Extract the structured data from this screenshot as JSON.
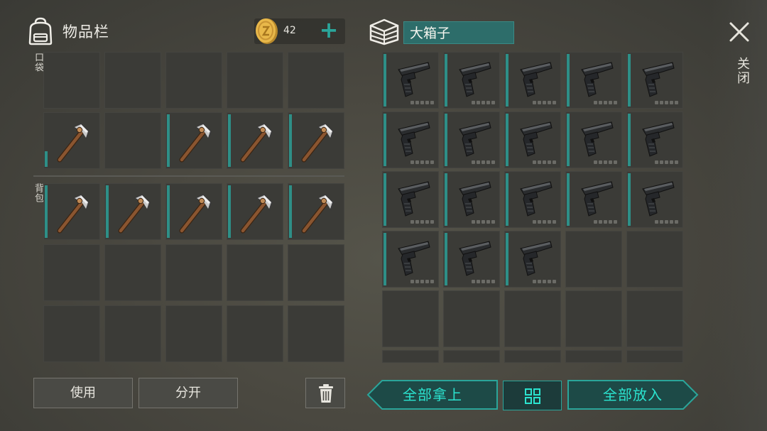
{
  "inventory": {
    "title": "物品栏",
    "pocket_label": "口袋",
    "backpack_label": "背包",
    "coins": "42",
    "coin_plus": "+"
  },
  "container": {
    "name": "大箱子"
  },
  "close_label": "关闭",
  "buttons": {
    "use": "使用",
    "split": "分开",
    "take_all": "全部拿上",
    "put_all": "全部放入"
  },
  "colors": {
    "accent": "#2aa59a",
    "teal_text": "#2be3cf",
    "durability_bar": "#2e8f87"
  },
  "icons": {
    "backpack": "backpack-icon",
    "coin": "coin-icon",
    "box": "box-stack-icon",
    "close": "close-icon",
    "trash": "trash-icon",
    "grid": "grid-view-icon",
    "pickaxe": "pickaxe-icon",
    "pistol": "pistol-icon"
  },
  "inventory_slots": {
    "pocket_row1": [
      "empty",
      "empty",
      "empty",
      "empty",
      "empty"
    ],
    "pocket_row2": [
      "pickaxe",
      "empty",
      "pickaxe",
      "pickaxe",
      "pickaxe"
    ],
    "backpack_row1": [
      "pickaxe",
      "pickaxe",
      "pickaxe",
      "pickaxe",
      "pickaxe"
    ],
    "backpack_row2": [
      "empty",
      "empty",
      "empty",
      "empty",
      "empty"
    ],
    "backpack_row3": [
      "empty",
      "empty",
      "empty",
      "empty",
      "empty"
    ]
  },
  "container_slots": {
    "row1": [
      "pistol",
      "pistol",
      "pistol",
      "pistol",
      "pistol"
    ],
    "row2": [
      "pistol",
      "pistol",
      "pistol",
      "pistol",
      "pistol"
    ],
    "row3": [
      "pistol",
      "pistol",
      "pistol",
      "pistol",
      "pistol"
    ],
    "row4": [
      "pistol",
      "pistol",
      "pistol",
      "empty",
      "empty"
    ],
    "row5": [
      "empty",
      "empty",
      "empty",
      "empty",
      "empty"
    ],
    "row6": [
      "empty",
      "empty",
      "empty",
      "empty",
      "empty"
    ]
  }
}
